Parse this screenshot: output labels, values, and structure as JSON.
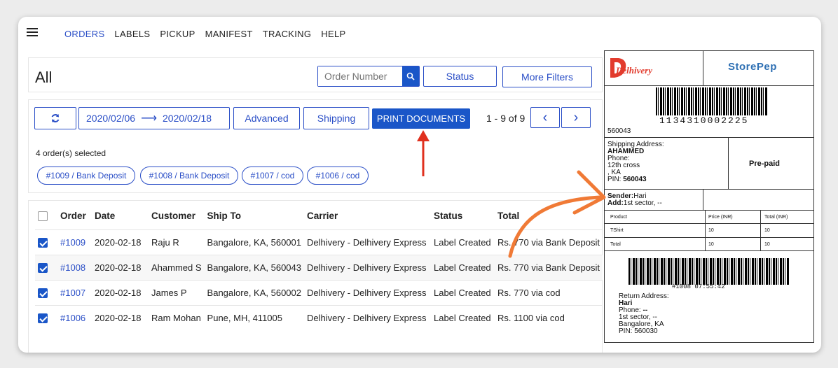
{
  "nav": {
    "items": [
      "ORDERS",
      "LABELS",
      "PICKUP",
      "MANIFEST",
      "TRACKING",
      "HELP"
    ],
    "active": "ORDERS"
  },
  "page": {
    "title": "All"
  },
  "search": {
    "placeholder": "Order Number"
  },
  "filters": {
    "status": "Status",
    "more": "More Filters"
  },
  "toolbar": {
    "date_from": "2020/02/06",
    "date_arrow": "⟶",
    "date_to": "2020/02/18",
    "advanced": "Advanced",
    "shipping": "Shipping",
    "print": "PRINT DOCUMENTS",
    "pagination": "1 - 9 of 9",
    "prev": "‹",
    "next": "›"
  },
  "selection": {
    "count_text": "4 order(s) selected",
    "chips": [
      "#1009 / Bank Deposit",
      "#1008 / Bank Deposit",
      "#1007 / cod",
      "#1006 / cod"
    ]
  },
  "table": {
    "headers": [
      "Order",
      "Date",
      "Customer",
      "Ship To",
      "Carrier",
      "Status",
      "Total"
    ],
    "rows": [
      [
        "#1009",
        "2020-02-18",
        "Raju R",
        "Bangalore, KA, 560001",
        "Delhivery - Delhivery Express",
        "Label Created",
        "Rs. 770 via Bank Deposit"
      ],
      [
        "#1008",
        "2020-02-18",
        "Ahammed S",
        "Bangalore, KA, 560043",
        "Delhivery - Delhivery Express",
        "Label Created",
        "Rs. 770 via Bank Deposit"
      ],
      [
        "#1007",
        "2020-02-18",
        "James P",
        "Bangalore, KA, 560002",
        "Delhivery - Delhivery Express",
        "Label Created",
        "Rs. 770 via cod"
      ],
      [
        "#1006",
        "2020-02-18",
        "Ram Mohan",
        "Pune, MH, 411005",
        "Delhivery - Delhivery Express",
        "Label Created",
        "Rs. 1100 via cod"
      ]
    ]
  },
  "label": {
    "carrier_logo": "Delhivery",
    "store_logo": "StorePep",
    "barcode_number": "1134310002225",
    "pin_top": "560043",
    "shipping_header": "Shipping Address:",
    "ship_name": "AHAMMED",
    "ship_phone": "Phone:",
    "ship_line1": "12th cross",
    "ship_line2": ", KA",
    "ship_pin_label": "PIN:",
    "ship_pin": "560043",
    "payment": "Pre-paid",
    "sender_label": "Sender:",
    "sender_name": "Hari",
    "add_label": "Add:",
    "add_value": "1st sector, --",
    "items_headers": [
      "Product",
      "Price (INR)",
      "Total (INR)"
    ],
    "items": [
      [
        "TShirt",
        "10",
        "10"
      ],
      [
        "Total",
        "10",
        "10"
      ]
    ],
    "barcode2_text": "#1008 07:55:42",
    "return_header": "Return Address:",
    "return_name": "Hari",
    "return_phone_label": "Phone:",
    "return_phone": "--",
    "return_line1": "1st sector, --",
    "return_line2": "Bangalore, KA",
    "return_pin": "PIN: 560030"
  },
  "colors": {
    "accent": "#1a56c8",
    "link": "#2b4fc7",
    "annotation_red": "#e0301e",
    "annotation_orange": "#f07a36"
  }
}
